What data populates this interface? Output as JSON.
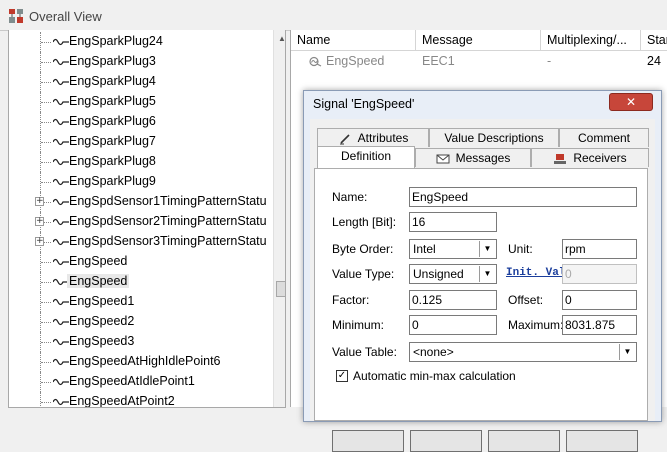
{
  "window": {
    "title": "Overall View"
  },
  "tree": {
    "items": [
      {
        "label": "EngSparkPlug24",
        "expandable": false
      },
      {
        "label": "EngSparkPlug3",
        "expandable": false
      },
      {
        "label": "EngSparkPlug4",
        "expandable": false
      },
      {
        "label": "EngSparkPlug5",
        "expandable": false
      },
      {
        "label": "EngSparkPlug6",
        "expandable": false
      },
      {
        "label": "EngSparkPlug7",
        "expandable": false
      },
      {
        "label": "EngSparkPlug8",
        "expandable": false
      },
      {
        "label": "EngSparkPlug9",
        "expandable": false
      },
      {
        "label": "EngSpdSensor1TimingPatternStatu",
        "expandable": true
      },
      {
        "label": "EngSpdSensor2TimingPatternStatu",
        "expandable": true
      },
      {
        "label": "EngSpdSensor3TimingPatternStatu",
        "expandable": true
      },
      {
        "label": "EngSpeed",
        "expandable": false
      },
      {
        "label": "EngSpeed",
        "expandable": false,
        "selected": true
      },
      {
        "label": "EngSpeed1",
        "expandable": false
      },
      {
        "label": "EngSpeed2",
        "expandable": false
      },
      {
        "label": "EngSpeed3",
        "expandable": false
      },
      {
        "label": "EngSpeedAtHighIdlePoint6",
        "expandable": false
      },
      {
        "label": "EngSpeedAtIdlePoint1",
        "expandable": false
      },
      {
        "label": "EngSpeedAtPoint2",
        "expandable": false
      }
    ]
  },
  "list": {
    "columns": [
      "Name",
      "Message",
      "Multiplexing/...",
      "Star"
    ],
    "rows": [
      {
        "name": "EngSpeed",
        "message": "EEC1",
        "multiplexing": "-",
        "start": "24"
      }
    ]
  },
  "dialog": {
    "title": "Signal 'EngSpeed'",
    "tabs_back": [
      "Attributes",
      "Value Descriptions",
      "Comment"
    ],
    "tabs_front": [
      "Definition",
      "Messages",
      "Receivers"
    ],
    "labels": {
      "name": "Name:",
      "length": "Length [Bit]:",
      "byte_order": "Byte Order:",
      "unit": "Unit:",
      "value_type": "Value Type:",
      "init_value": "Init. Val",
      "factor": "Factor:",
      "offset": "Offset:",
      "minimum": "Minimum:",
      "maximum": "Maximum:",
      "value_table": "Value Table:",
      "auto_minmax": "Automatic min-max calculation"
    },
    "values": {
      "name": "EngSpeed",
      "length": "16",
      "byte_order": "Intel",
      "unit": "rpm",
      "value_type": "Unsigned",
      "init_value": "0",
      "factor": "0.125",
      "offset": "0",
      "minimum": "0",
      "maximum": "8031.875",
      "value_table": "<none>",
      "auto_minmax_checked": true
    }
  },
  "icons": {
    "app": "network-view-icon",
    "signal": "signal-wave-icon",
    "expand": "expand-plus-icon"
  },
  "colors": {
    "close_button": "#c7463a",
    "link": "#1b3e9c",
    "selection": "#e8e8e8"
  }
}
